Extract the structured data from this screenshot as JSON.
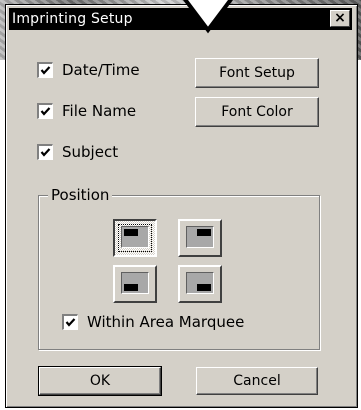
{
  "dialog": {
    "title": "Imprinting Setup",
    "close_glyph": "×"
  },
  "options": {
    "date_time": {
      "label": "Date/Time",
      "checked": true
    },
    "file_name": {
      "label": "File Name",
      "checked": true
    },
    "subject": {
      "label": "Subject",
      "checked": true
    }
  },
  "buttons": {
    "font_setup": "Font Setup",
    "font_color": "Font Color",
    "ok": "OK",
    "cancel": "Cancel"
  },
  "position": {
    "legend": "Position",
    "selected": "top-left",
    "options": [
      "top-left",
      "top-right",
      "bottom-left",
      "bottom-right"
    ],
    "within_area_marquee": {
      "label": "Within Area Marquee",
      "checked": true
    }
  },
  "icons": {
    "check": "check-icon",
    "close": "close-icon"
  },
  "colors": {
    "dialog_face": "#d4d0c8",
    "titlebar": "#000000",
    "title_text": "#ffffff"
  }
}
